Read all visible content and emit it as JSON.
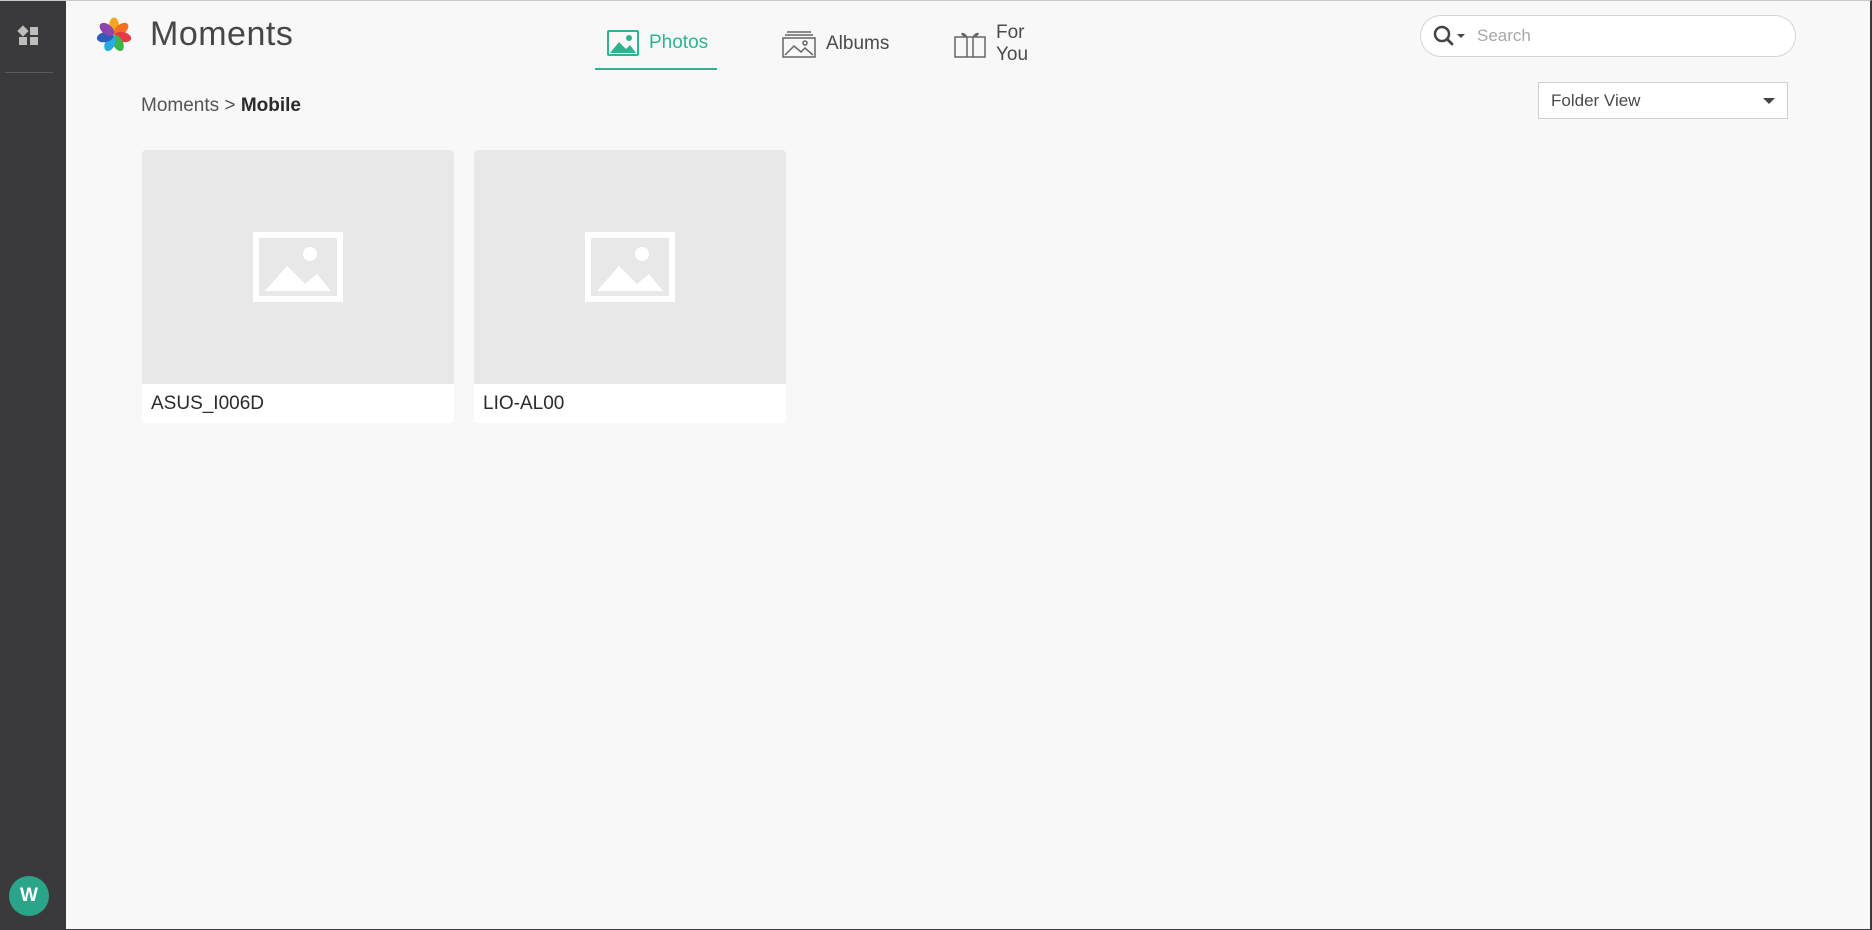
{
  "app": {
    "title": "Moments"
  },
  "sidebar": {
    "apps_icon": "apps-grid-icon",
    "avatar_initial": "W",
    "avatar_color": "#2ba58a"
  },
  "nav": {
    "tabs": [
      {
        "label": "Photos",
        "icon": "photo-icon",
        "active": true
      },
      {
        "label": "Albums",
        "icon": "album-stack-icon",
        "active": false
      },
      {
        "label": "For You",
        "icon": "gift-icon",
        "active": false
      }
    ],
    "accent_color": "#2fb38f"
  },
  "search": {
    "placeholder": "Search",
    "value": "",
    "icon": "search-icon"
  },
  "breadcrumb": {
    "parent": "Moments",
    "separator": ">",
    "current": "Mobile"
  },
  "view_select": {
    "selected": "Folder View"
  },
  "folders": [
    {
      "name": "ASUS_I006D",
      "thumbnail_icon": "image-placeholder-icon"
    },
    {
      "name": "LIO-AL00",
      "thumbnail_icon": "image-placeholder-icon"
    }
  ]
}
